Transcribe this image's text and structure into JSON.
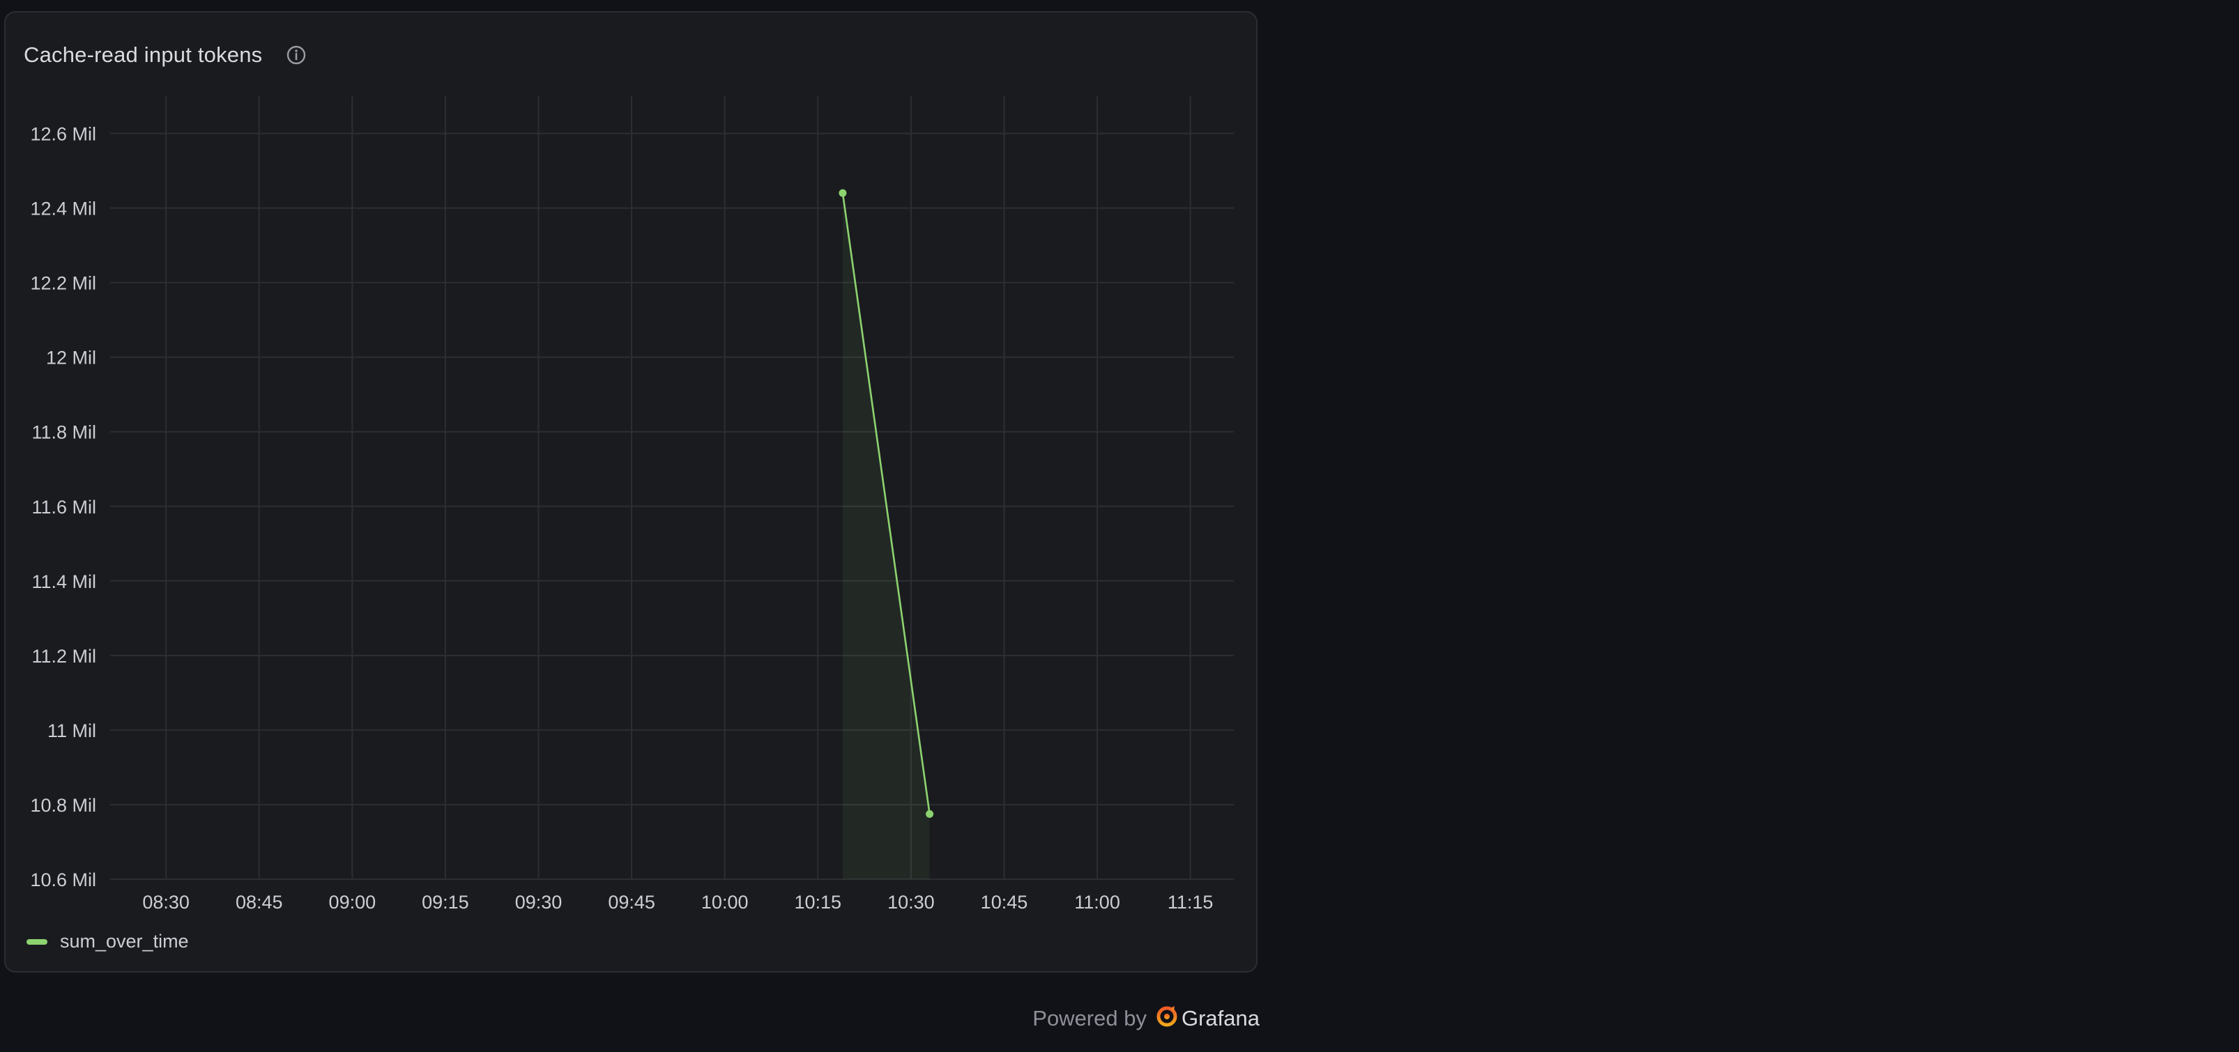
{
  "panel": {
    "title": "Cache-read input tokens",
    "info_icon": "info-circle-icon"
  },
  "footer": {
    "powered_by": "Powered by",
    "brand": "Grafana",
    "brand_icon": "grafana-logo-icon"
  },
  "colors": {
    "series": "#8dd36f",
    "grid": "#2c2e33",
    "tick_text": "#ccced4",
    "background": "#111217",
    "panel": "#1a1b1f"
  },
  "chart_data": {
    "type": "line",
    "title": "Cache-read input tokens",
    "xlabel": "",
    "ylabel": "",
    "x_ticks": [
      "08:30",
      "08:45",
      "09:00",
      "09:15",
      "09:30",
      "09:45",
      "10:00",
      "10:15",
      "10:30",
      "10:45",
      "11:00",
      "11:15"
    ],
    "y_ticks": [
      "10.6 Mil",
      "10.8 Mil",
      "11 Mil",
      "11.2 Mil",
      "11.4 Mil",
      "11.6 Mil",
      "11.8 Mil",
      "12 Mil",
      "12.2 Mil",
      "12.4 Mil",
      "12.6 Mil"
    ],
    "ylim": [
      10600000,
      12700000
    ],
    "xlim": [
      "08:21",
      "11:22"
    ],
    "grid": true,
    "legend_position": "bottom-left",
    "series": [
      {
        "name": "sum_over_time",
        "x": [
          "10:19",
          "10:33"
        ],
        "values": [
          12440000,
          10775000
        ]
      }
    ]
  }
}
